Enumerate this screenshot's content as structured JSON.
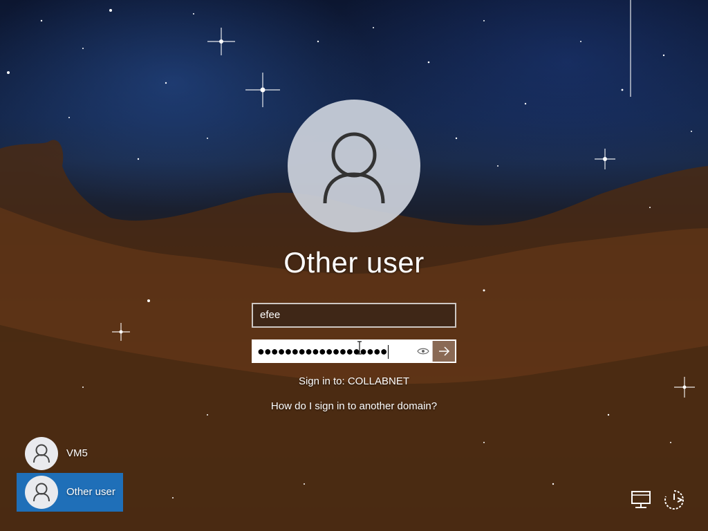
{
  "lock_screen": {
    "selected_user_title": "Other user",
    "username_value": "efee",
    "password_mask": "●●●●●●●●●●●●●●●●●●●",
    "sign_in_to_label": "Sign in to: COLLABNET",
    "domain_help_link": "How do I sign in to another domain?"
  },
  "user_list": [
    {
      "label": "VM5",
      "selected": false
    },
    {
      "label": "Other user",
      "selected": true
    }
  ],
  "icons": {
    "avatar": "person-icon",
    "reveal": "eye-icon",
    "submit": "arrow-right-icon",
    "network": "network-icon",
    "power": "power-icon"
  },
  "colors": {
    "selected_tile": "#1f6fb8",
    "avatar_circle": "#cdd2dc"
  }
}
